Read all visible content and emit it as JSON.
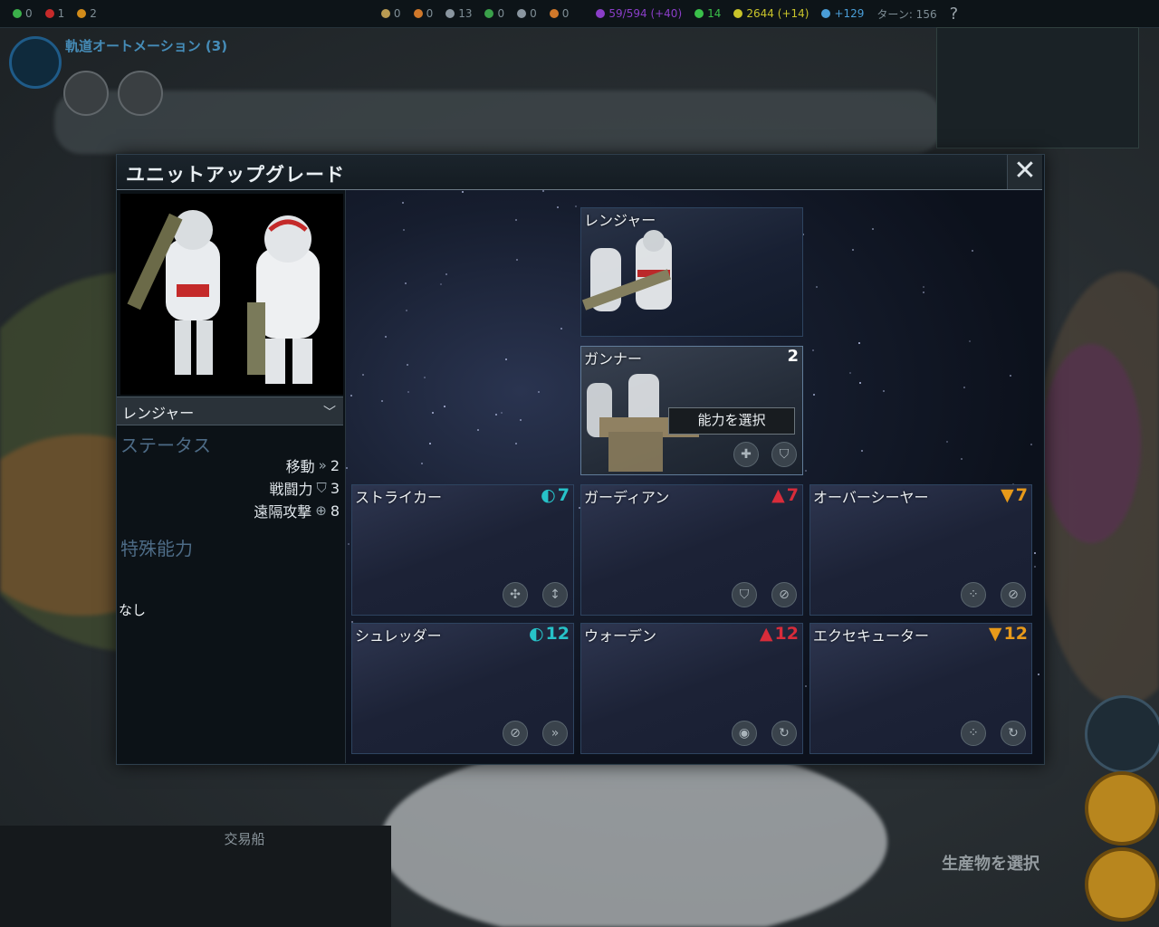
{
  "top_bar": {
    "items": [
      {
        "icon": "science-icon",
        "value": "0",
        "color": "#3bb04a"
      },
      {
        "icon": "culture-icon",
        "value": "1",
        "color": "#c62a2a"
      },
      {
        "icon": "affinity-icon",
        "value": "2",
        "color": "#d28c1a"
      },
      {
        "icon": "resource-icon",
        "value": "0",
        "color": "#b99b52"
      },
      {
        "icon": "resource-icon",
        "value": "0",
        "color": "#d0782a"
      },
      {
        "icon": "population-icon",
        "value": "13",
        "color": "#8a96a0"
      },
      {
        "icon": "resource-icon",
        "value": "0",
        "color": "#3aa04a"
      },
      {
        "icon": "resource-icon",
        "value": "0",
        "color": "#8a96a0"
      },
      {
        "icon": "resource-icon",
        "value": "0",
        "color": "#d0782a"
      },
      {
        "icon": "culture-total-icon",
        "value": "59/594 (+40)",
        "color": "#8a3ec8"
      },
      {
        "icon": "health-icon",
        "value": "14",
        "color": "#3ac04a"
      },
      {
        "icon": "energy-icon",
        "value": "2644 (+14)",
        "color": "#c9c42a"
      },
      {
        "icon": "science-rate-icon",
        "value": "+129",
        "color": "#4a9ed8"
      }
    ],
    "turn": "ターン: 156",
    "help": "?"
  },
  "automation": {
    "label": "軌道オートメーション (3)"
  },
  "modal": {
    "title": "ユニットアップグレード",
    "close": "✕",
    "unit": {
      "name": "レンジャー",
      "status_header": "ステータス",
      "stats": [
        {
          "label": "移動",
          "icon": "move-icon",
          "value": "2"
        },
        {
          "label": "戦闘力",
          "icon": "shield-icon",
          "value": "3"
        },
        {
          "label": "遠隔攻撃",
          "icon": "crosshair-icon",
          "value": "8"
        }
      ],
      "special_header": "特殊能力",
      "special_value": "なし"
    },
    "tree": {
      "base": {
        "name": "レンジャー"
      },
      "selected": {
        "name": "ガンナー",
        "level": "2",
        "choose_label": "能力を選択"
      },
      "tier1": [
        {
          "name": "ストライカー",
          "cost": "7",
          "affinity": "purity",
          "color": "#27c2c8"
        },
        {
          "name": "ガーディアン",
          "cost": "7",
          "affinity": "harmony",
          "color": "#d82c3a"
        },
        {
          "name": "オーバーシーヤー",
          "cost": "7",
          "affinity": "supremacy",
          "color": "#e89a1a"
        }
      ],
      "tier2": [
        {
          "name": "シュレッダー",
          "cost": "12",
          "affinity": "purity",
          "color": "#27c2c8"
        },
        {
          "name": "ウォーデン",
          "cost": "12",
          "affinity": "harmony",
          "color": "#d82c3a"
        },
        {
          "name": "エクセキューター",
          "cost": "12",
          "affinity": "supremacy",
          "color": "#e89a1a"
        }
      ]
    }
  },
  "bottom": {
    "unit_name": "交易船",
    "produce": "生産物を選択"
  }
}
